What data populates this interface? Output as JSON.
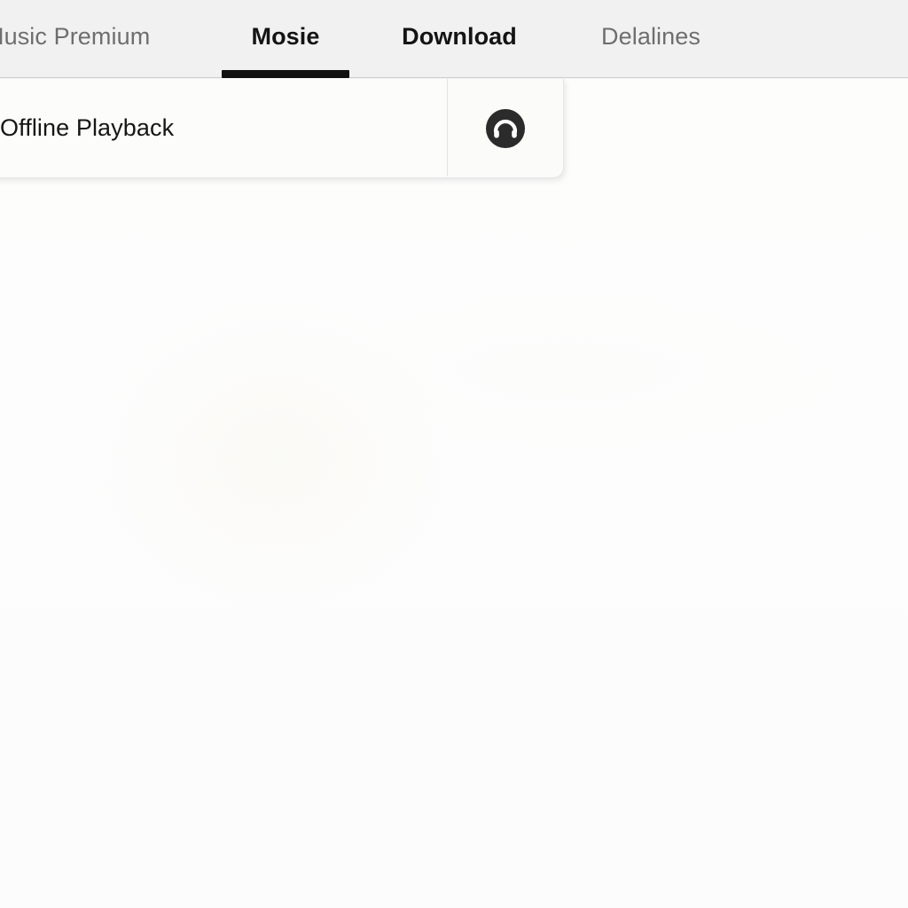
{
  "window": {
    "title": "Music Premium",
    "background_color": "#fefefe"
  },
  "header": {
    "background_color": "#f1f1f1",
    "border_color": "#d8d8d8",
    "active_indicator_color": "#111111",
    "active_text_color": "#141414",
    "inactive_text_color": "#6e6e6e",
    "tabs": [
      {
        "label": "Music Premium",
        "active": false
      },
      {
        "label": "Mosie",
        "active": true
      },
      {
        "label": "Download",
        "active": true
      },
      {
        "label": "Delalines",
        "active": false
      }
    ]
  },
  "panel": {
    "background_color": "#fcfcfb",
    "border_color": "#e6e6e6",
    "title": "Offline Playback",
    "action": {
      "icon": "headphone-icon",
      "icon_color": "#2b2b2b",
      "label": "Headphones"
    }
  },
  "content": {
    "body_background": "#fdfdfc",
    "text": ""
  }
}
